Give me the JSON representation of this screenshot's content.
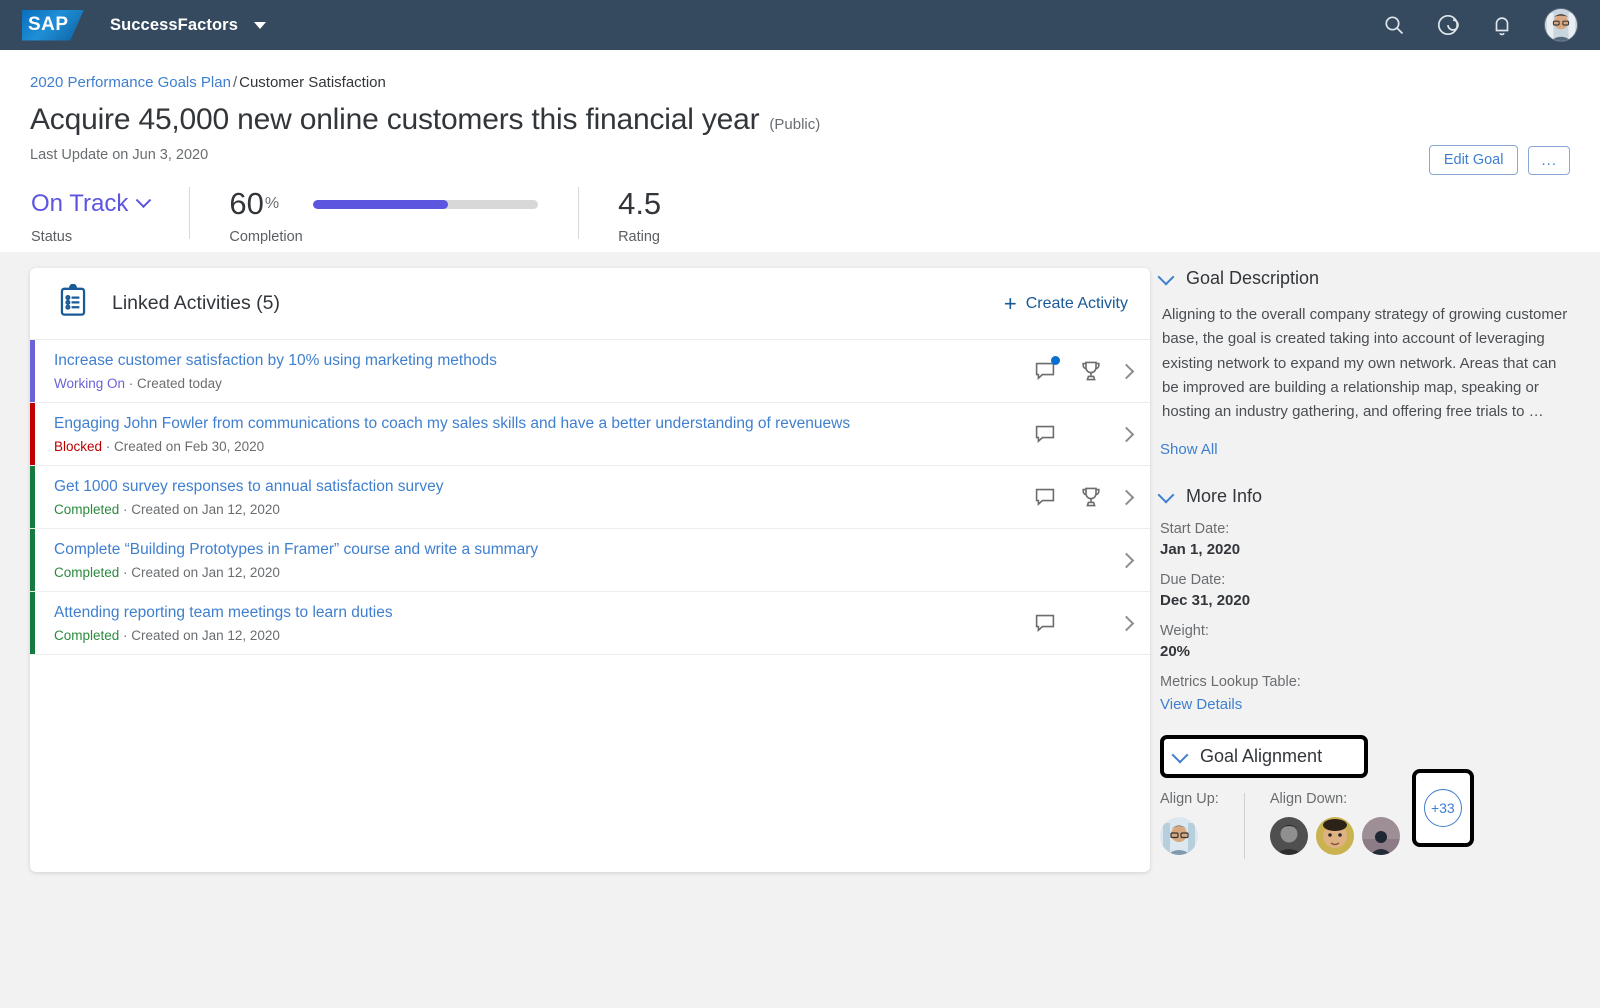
{
  "topbar": {
    "logo_text": "SAP",
    "brand": "SuccessFactors",
    "icons": [
      "search-icon",
      "target-icon",
      "notifications-bell-icon",
      "user-avatar"
    ]
  },
  "header": {
    "breadcrumb_link": "2020 Performance Goals Plan",
    "breadcrumb_sep": "/",
    "breadcrumb_current": "Customer Satisfaction",
    "title": "Acquire 45,000 new online customers this financial year",
    "visibility": "(Public)",
    "last_update": "Last Update on Jun 3, 2020",
    "edit_goal_label": "Edit Goal",
    "more_actions_label": "..."
  },
  "kpis": {
    "status": {
      "value": "On Track",
      "label": "Status"
    },
    "completion": {
      "value": "60",
      "unit": "%",
      "percent": 60,
      "label": "Completion"
    },
    "rating": {
      "value": "4.5",
      "label": "Rating"
    }
  },
  "activities_card": {
    "title": "Linked Activities (5)",
    "create_label": "Create Activity",
    "rows": [
      {
        "name": "Increase customer satisfaction by 10% using marketing methods",
        "status": "Working On",
        "status_color": "#6a62d6",
        "bar_color": "#6a62d6",
        "created": "· Created today",
        "has_comment": true,
        "comment_unread": true,
        "has_trophy": true
      },
      {
        "name": "Engaging John Fowler from communications to coach my sales skills and have a better understanding of revenuews",
        "status": "Blocked",
        "status_color": "#bb0000",
        "bar_color": "#c00000",
        "created": "· Created on Feb 30, 2020",
        "has_comment": true,
        "comment_unread": false,
        "has_trophy": false
      },
      {
        "name": "Get 1000 survey responses to annual satisfaction survey",
        "status": "Completed",
        "status_color": "#2b8a3e",
        "bar_color": "#16793f",
        "created": "· Created on Jan 12, 2020",
        "has_comment": true,
        "comment_unread": false,
        "has_trophy": true
      },
      {
        "name": "Complete “Building Prototypes in Framer” course and write a summary",
        "status": "Completed",
        "status_color": "#2b8a3e",
        "bar_color": "#16793f",
        "created": "· Created on Jan 12, 2020",
        "has_comment": false,
        "comment_unread": false,
        "has_trophy": false
      },
      {
        "name": "Attending reporting team meetings to learn duties",
        "status": "Completed",
        "status_color": "#2b8a3e",
        "bar_color": "#16793f",
        "created": "· Created on Jan 12, 2020",
        "has_comment": true,
        "comment_unread": false,
        "has_trophy": false
      }
    ]
  },
  "sidebar": {
    "goal_description": {
      "heading": "Goal Description",
      "text": "Aligning to the overall company strategy of growing customer base, the goal is created taking into account of leveraging existing network to expand my own network. Areas that can be improved are building a relationship map, speaking or hosting an industry gathering, and offering free trials to …",
      "show_all": "Show All"
    },
    "more_info": {
      "heading": "More Info",
      "fields": [
        {
          "label": "Start Date:",
          "value": "Jan 1, 2020"
        },
        {
          "label": "Due Date:",
          "value": "Dec 31, 2020"
        },
        {
          "label": "Weight:",
          "value": "20%"
        }
      ],
      "metrics_label": "Metrics Lookup Table:",
      "metrics_link": "View Details"
    },
    "goal_alignment": {
      "heading": "Goal Alignment",
      "align_up_label": "Align Up:",
      "align_down_label": "Align Down:",
      "align_up_count": 1,
      "align_down_count": 3,
      "overflow_count": "+33"
    }
  },
  "colors": {
    "topbar": "#354a5f",
    "accent_link": "#3f7fcf",
    "progress": "#5b55e0",
    "page_bg": "#f2f2f2",
    "highlight_outline": "#000000"
  }
}
